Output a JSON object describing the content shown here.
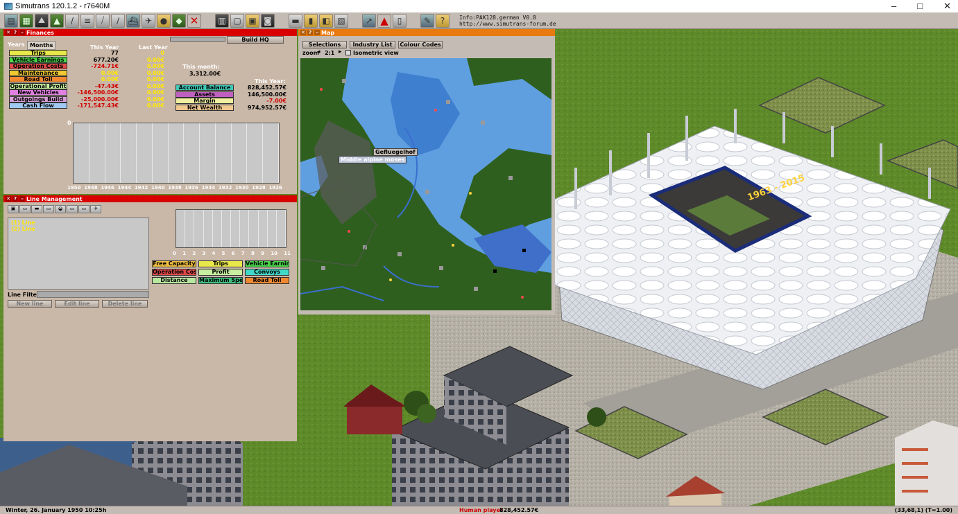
{
  "app": {
    "title": "Simutrans 120.1.2 - r7640M",
    "info_line1": "Info:PAK128.german  V0.8",
    "info_line2": "http://www.simutrans-forum.de"
  },
  "toolbar": {
    "icons": [
      "save-icon",
      "map-icon",
      "landscape-icon",
      "raise-land-icon",
      "road-icon",
      "rail-icon",
      "tram-icon",
      "monorail-icon",
      "ship-icon",
      "airport-icon",
      "special-icon",
      "terrain-icon",
      "remove-icon",
      "list-icon",
      "grid-icon",
      "help-icon",
      "finance-icon",
      "message-icon",
      "money-icon",
      "color-icon",
      "schedule-icon",
      "chart-icon",
      "depot-icon",
      "options-icon",
      "about-icon"
    ]
  },
  "finance": {
    "title": "Finances",
    "tabs": [
      "Years",
      "Months"
    ],
    "build_button": "Build HQ",
    "col_this_year": "This Year",
    "col_last_year": "Last Year",
    "this_month_label": "This month:",
    "this_month_value": "3,312.00€",
    "this_year_label": "This Year:",
    "rows": [
      {
        "label": "Trips",
        "color": "#e8e84a",
        "this": "77",
        "last": "0",
        "this_cls": "",
        "last_cls": "yel"
      },
      {
        "label": "Vehicle Earnings",
        "color": "#4ad84a",
        "this": "677.20€",
        "last": "0.00€",
        "this_cls": "",
        "last_cls": "yel"
      },
      {
        "label": "Operation Costs",
        "color": "#e04848",
        "this": "-724.71€",
        "last": "0.00€",
        "this_cls": "red",
        "last_cls": "yel"
      },
      {
        "label": "Maintenance",
        "color": "#f0c830",
        "this": "0.00€",
        "last": "0.00€",
        "this_cls": "yel",
        "last_cls": "yel"
      },
      {
        "label": "Road Toll",
        "color": "#f08830",
        "this": "0.00€",
        "last": "0.00€",
        "this_cls": "yel",
        "last_cls": "yel"
      },
      {
        "label": "Operational Profit",
        "color": "#c8f0a0",
        "this": "-47.43€",
        "last": "0.00€",
        "this_cls": "red",
        "last_cls": "yel"
      },
      {
        "label": "New Vehicles",
        "color": "#e080e0",
        "this": "-146,500.00€",
        "last": "0.00€",
        "this_cls": "red",
        "last_cls": "yel"
      },
      {
        "label": "Outgoings Build",
        "color": "#d8a0d8",
        "this": "-25,000.00€",
        "last": "0.00€",
        "this_cls": "red",
        "last_cls": "yel"
      },
      {
        "label": "Cash Flow",
        "color": "#a0c8f0",
        "this": "-171,547.43€",
        "last": "0.00€",
        "this_cls": "red",
        "last_cls": "yel"
      }
    ],
    "right_rows": [
      {
        "label": "Account Balance",
        "color": "#40c8b8",
        "value": "828,452.57€",
        "cls": ""
      },
      {
        "label": "Assets",
        "color": "#c060c0",
        "value": "146,500.00€",
        "cls": ""
      },
      {
        "label": "Margin",
        "color": "#f0f0a0",
        "value": "-7.00€",
        "cls": "red"
      },
      {
        "label": "Net Wealth",
        "color": "#f0c890",
        "value": "974,952.57€",
        "cls": ""
      }
    ],
    "chart_y_label": "0",
    "chart_years": [
      "1950",
      "1948",
      "1946",
      "1944",
      "1942",
      "1940",
      "1938",
      "1936",
      "1934",
      "1932",
      "1930",
      "1928",
      "1926"
    ]
  },
  "line_mgmt": {
    "title": "Line Management",
    "tab_icons": [
      "all-lines-icon",
      "truck-icon",
      "train-icon",
      "tram-icon",
      "ship-icon",
      "monorail-icon",
      "maglev-icon",
      "airplane-icon"
    ],
    "lines": [
      "(1) Line",
      "(2) Line"
    ],
    "line_filter": "Line Filter",
    "new_line": "New line",
    "edit_line": "Edit line",
    "delete_line": "Delete line",
    "chart_months": [
      "0",
      "1",
      "2",
      "3",
      "4",
      "5",
      "6",
      "7",
      "8",
      "9",
      "10",
      "11"
    ],
    "legend": [
      {
        "label": "Free Capacity",
        "color": "#f0c040"
      },
      {
        "label": "Trips",
        "color": "#e8e84a"
      },
      {
        "label": "Vehicle Earnin...",
        "color": "#4ad84a"
      },
      {
        "label": "Operation Cos...",
        "color": "#e04848"
      },
      {
        "label": "Profit",
        "color": "#c8f0a0"
      },
      {
        "label": "Convoys",
        "color": "#40d8c8"
      },
      {
        "label": "Distance",
        "color": "#b8e8a0"
      },
      {
        "label": "Maximum Speed",
        "color": "#40c080"
      },
      {
        "label": "Road Toll",
        "color": "#f08830"
      }
    ]
  },
  "map": {
    "title": "Map",
    "selections": "Selections",
    "industry_list": "Industry List",
    "colour_codes": "Colour Codes",
    "zoom_label": "zoom",
    "zoom_value": "2:1",
    "isometric": "Isometric view",
    "label_poultry": "Gefluegelhof",
    "label_town": "Middle alpine moses"
  },
  "scene": {
    "stadium_sign": "1963 - 2015"
  },
  "status": {
    "date": "Winter, 26. January 1950 10:25h",
    "player": "Human player",
    "balance": "828,452.57€",
    "coords": "(33,68,1) (T=1.00)"
  }
}
